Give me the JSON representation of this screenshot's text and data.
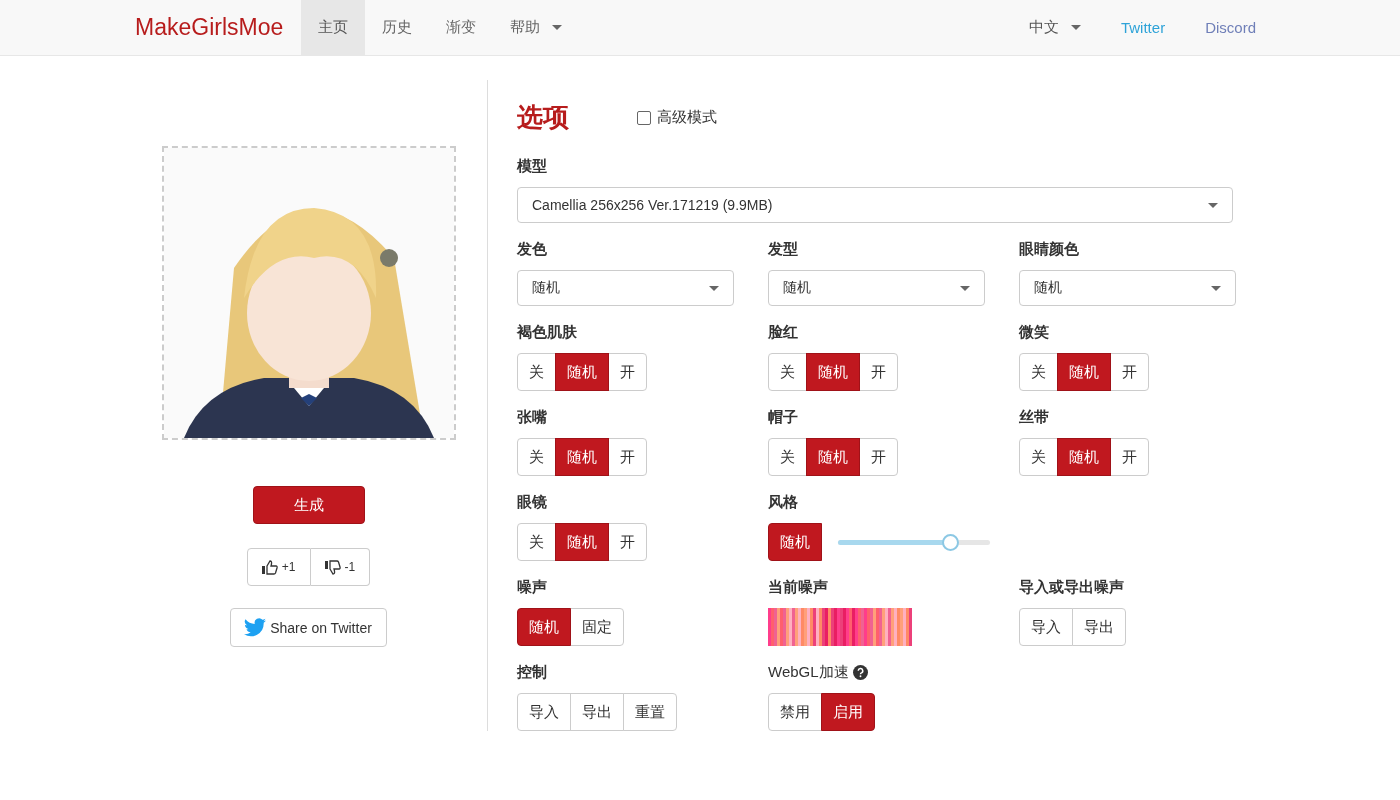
{
  "nav": {
    "brand": "MakeGirlsMoe",
    "items": [
      {
        "label": "主页",
        "selected": true,
        "dropdown": false
      },
      {
        "label": "历史",
        "selected": false,
        "dropdown": false
      },
      {
        "label": "渐变",
        "selected": false,
        "dropdown": false
      },
      {
        "label": "帮助",
        "selected": false,
        "dropdown": true
      }
    ],
    "right": [
      {
        "label": "中文",
        "kind": "dropdown",
        "color": "#555555"
      },
      {
        "label": "Twitter",
        "kind": "link",
        "color": "#2ea3d8"
      },
      {
        "label": "Discord",
        "kind": "link",
        "color": "#6f7fb8"
      }
    ]
  },
  "left": {
    "generate": "生成",
    "votes": [
      {
        "kind": "up",
        "label": "+1"
      },
      {
        "kind": "down",
        "label": "-1"
      }
    ],
    "share": "Share on Twitter"
  },
  "options": {
    "title": "选项",
    "advanced": {
      "label": "高级模式",
      "checked": false
    },
    "model": {
      "label": "模型",
      "value": "Camellia 256x256 Ver.171219 (9.9MB)"
    },
    "rows": [
      [
        {
          "kind": "select",
          "label": "发色",
          "value": "随机"
        },
        {
          "kind": "select",
          "label": "发型",
          "value": "随机"
        },
        {
          "kind": "select",
          "label": "眼睛颜色",
          "value": "随机"
        }
      ],
      [
        {
          "kind": "toggle",
          "label": "褐色肌肤",
          "buttons": [
            {
              "label": "关",
              "selected": false
            },
            {
              "label": "随机",
              "selected": true
            },
            {
              "label": "开",
              "selected": false
            }
          ]
        },
        {
          "kind": "toggle",
          "label": "脸红",
          "buttons": [
            {
              "label": "关",
              "selected": false
            },
            {
              "label": "随机",
              "selected": true
            },
            {
              "label": "开",
              "selected": false
            }
          ]
        },
        {
          "kind": "toggle",
          "label": "微笑",
          "buttons": [
            {
              "label": "关",
              "selected": false
            },
            {
              "label": "随机",
              "selected": true
            },
            {
              "label": "开",
              "selected": false
            }
          ]
        }
      ],
      [
        {
          "kind": "toggle",
          "label": "张嘴",
          "buttons": [
            {
              "label": "关",
              "selected": false
            },
            {
              "label": "随机",
              "selected": true
            },
            {
              "label": "开",
              "selected": false
            }
          ]
        },
        {
          "kind": "toggle",
          "label": "帽子",
          "buttons": [
            {
              "label": "关",
              "selected": false
            },
            {
              "label": "随机",
              "selected": true
            },
            {
              "label": "开",
              "selected": false
            }
          ]
        },
        {
          "kind": "toggle",
          "label": "丝带",
          "buttons": [
            {
              "label": "关",
              "selected": false
            },
            {
              "label": "随机",
              "selected": true
            },
            {
              "label": "开",
              "selected": false
            }
          ]
        }
      ],
      [
        {
          "kind": "toggle",
          "label": "眼镜",
          "buttons": [
            {
              "label": "关",
              "selected": false
            },
            {
              "label": "随机",
              "selected": true
            },
            {
              "label": "开",
              "selected": false
            }
          ]
        },
        {
          "kind": "slider",
          "label": "风格",
          "buttons": [
            {
              "label": "随机",
              "selected": true
            }
          ],
          "level": 0.74
        }
      ],
      [
        {
          "kind": "toggle",
          "label": "噪声",
          "buttons": [
            {
              "label": "随机",
              "selected": true
            },
            {
              "label": "固定",
              "selected": false
            }
          ]
        },
        {
          "kind": "noise",
          "label": "当前噪声"
        },
        {
          "kind": "toggle",
          "label": "导入或导出噪声",
          "buttons": [
            {
              "label": "导入",
              "selected": false
            },
            {
              "label": "导出",
              "selected": false
            }
          ]
        }
      ],
      [
        {
          "kind": "toggle",
          "label": "控制",
          "buttons": [
            {
              "label": "导入",
              "selected": false
            },
            {
              "label": "导出",
              "selected": false
            },
            {
              "label": "重置",
              "selected": false
            }
          ]
        },
        {
          "kind": "toggle",
          "label": "WebGL加速",
          "help": true,
          "buttons": [
            {
              "label": "禁用",
              "selected": false
            },
            {
              "label": "启用",
              "selected": true
            }
          ]
        }
      ]
    ]
  }
}
